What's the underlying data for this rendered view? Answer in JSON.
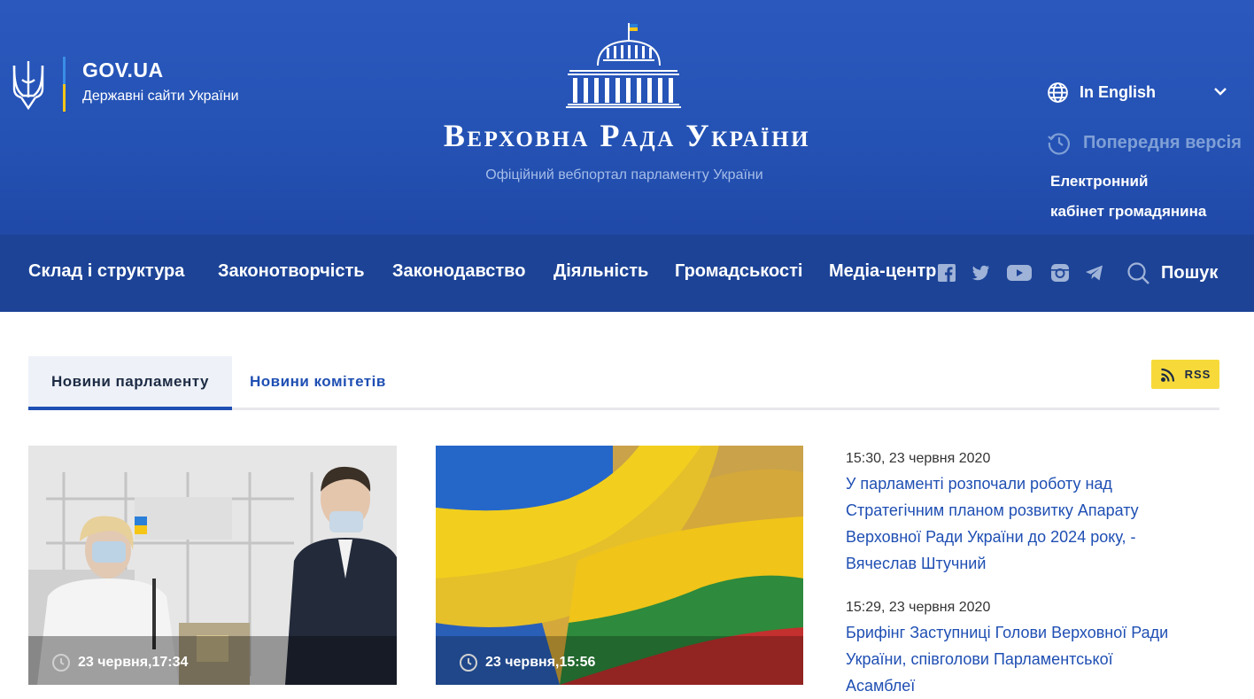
{
  "colors": {
    "header_blue": "#2452b4",
    "nav_blue": "#1c4396",
    "accent_yellow": "#f7d93a",
    "link_blue": "#1f4fb3"
  },
  "gov": {
    "title": "GOV.UA",
    "subtitle": "Державні сайти України"
  },
  "site": {
    "title": "Верховна Рада України",
    "subtitle": "Офіційний вебпортал парламенту України"
  },
  "header_right": {
    "language": "In English",
    "previous_version": "Попередня версія",
    "cabinet_line1": "Електронний",
    "cabinet_line2": "кабінет громадянина"
  },
  "nav": {
    "items": [
      "Склад і структура",
      "Законотворчість",
      "Законодавство",
      "Діяльність",
      "Громадськості",
      "Медіа-центр"
    ],
    "social_icons": [
      "facebook-icon",
      "twitter-icon",
      "youtube-icon",
      "instagram-icon",
      "telegram-icon"
    ],
    "search_label": "Пошук"
  },
  "tabs": {
    "active": "Новини парламенту",
    "other": "Новини комітетів",
    "rss": "RSS"
  },
  "featured": [
    {
      "date": "23 червня,17:34"
    },
    {
      "date": "23 червня,15:56"
    }
  ],
  "news": [
    {
      "time": "15:30, 23 червня 2020",
      "title": "У парламенті розпочали роботу над Стратегічним планом розвитку Апарату Верховної Ради України до 2024 року, - Вячеслав Штучний"
    },
    {
      "time": "15:29, 23 червня 2020",
      "title": "Брифінг Заступниці Голови Верховної Ради України, співголови Парламентської Асамблеї"
    }
  ]
}
